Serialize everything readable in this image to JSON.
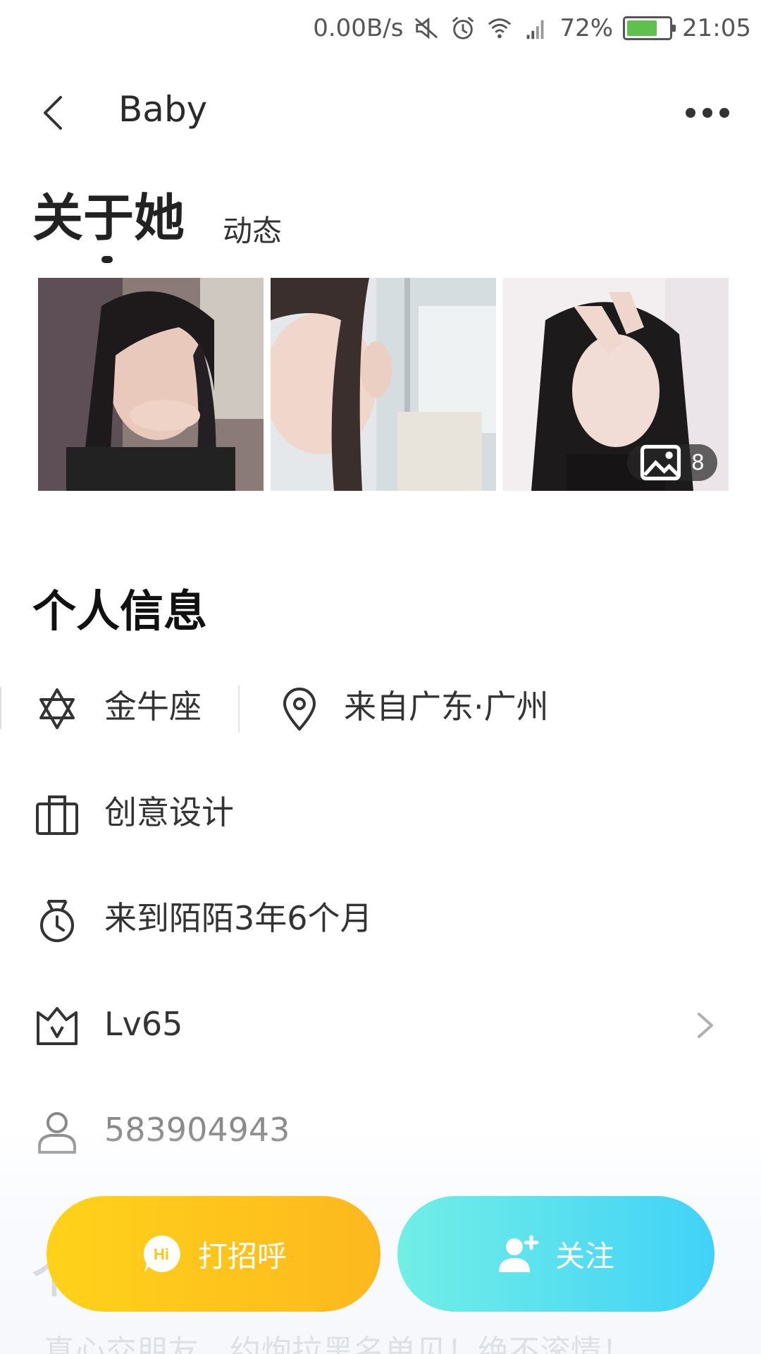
{
  "status_bar": {
    "net_speed": "0.00B/s",
    "battery": "72%",
    "time": "21:05",
    "battery_level": 0.72,
    "battery_color": "#5fc04e"
  },
  "nav": {
    "title": "Baby"
  },
  "tabs": [
    {
      "label": "关于她",
      "active": true
    },
    {
      "label": "动态",
      "active": false
    }
  ],
  "photos": {
    "count": "8"
  },
  "personal_info": {
    "title": "个人信息",
    "zodiac": "金牛座",
    "location": "来自广东·广州",
    "occupation": "创意设计",
    "tenure": "来到陌陌3年6个月",
    "level": "Lv65",
    "user_id": "583904943"
  },
  "signature": {
    "title": "个性签名",
    "text": "真心交朋友，约炮拉黑名单见！绝不滚情！"
  },
  "actions": {
    "greet_label": "打招呼",
    "follow_label": "关注",
    "greet_color": "#fdc21c",
    "follow_color": "#4fdaf4"
  }
}
